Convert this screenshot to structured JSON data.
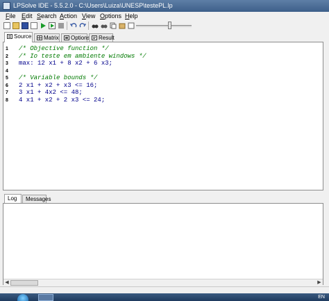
{
  "window": {
    "title": "LPSolve IDE - 5.5.2.0 - C:\\Users\\Luiza\\UNESP\\testePL.lp"
  },
  "menu": [
    {
      "label": "File",
      "ul": "F",
      "rest": "ile"
    },
    {
      "label": "Edit",
      "ul": "E",
      "rest": "dit"
    },
    {
      "label": "Search",
      "ul": "S",
      "rest": "earch"
    },
    {
      "label": "Action",
      "ul": "A",
      "rest": "ction"
    },
    {
      "label": "View",
      "ul": "V",
      "rest": "iew"
    },
    {
      "label": "Options",
      "ul": "O",
      "rest": "ptions"
    },
    {
      "label": "Help",
      "ul": "H",
      "rest": "elp"
    }
  ],
  "toolbar": {
    "icons": [
      "new-file-icon",
      "open-folder-icon",
      "save-icon",
      "play-icon",
      "step-icon",
      "stop-icon",
      "undo-icon",
      "redo-icon",
      "cut-icon",
      "find-icon",
      "find-next-icon",
      "copy-icon",
      "paste-icon",
      "clear-icon"
    ]
  },
  "tabs": {
    "source": "Source",
    "matrix": "Matrix",
    "options": "Options",
    "result": "Result"
  },
  "editor": {
    "lines": [
      {
        "n": "1",
        "text": "/* Objective function */",
        "kind": "comment"
      },
      {
        "n": "2",
        "text": "/* Io teste em ambiente windows */",
        "kind": "comment"
      },
      {
        "n": "3",
        "text": "max: 12 x1 + 8 x2 + 6 x3;",
        "kind": "code"
      },
      {
        "n": "4",
        "text": "",
        "kind": "code"
      },
      {
        "n": "5",
        "text": "/* Variable bounds */",
        "kind": "comment"
      },
      {
        "n": "6",
        "text": "2 x1 + x2 + x3 <= 16;",
        "kind": "code"
      },
      {
        "n": "7",
        "text": "3 x1 + 4x2 <= 48;",
        "kind": "code"
      },
      {
        "n": "8",
        "text": "4 x1 + x2 + 2 x3 <= 24;",
        "kind": "code"
      }
    ]
  },
  "bottom_tabs": {
    "log": "Log",
    "messages": "Messages"
  },
  "tray": {
    "lang": "EN"
  },
  "colors": {
    "titlebar": "#3d5f8a",
    "comment": "#007a00",
    "keyword": "#00008b"
  }
}
